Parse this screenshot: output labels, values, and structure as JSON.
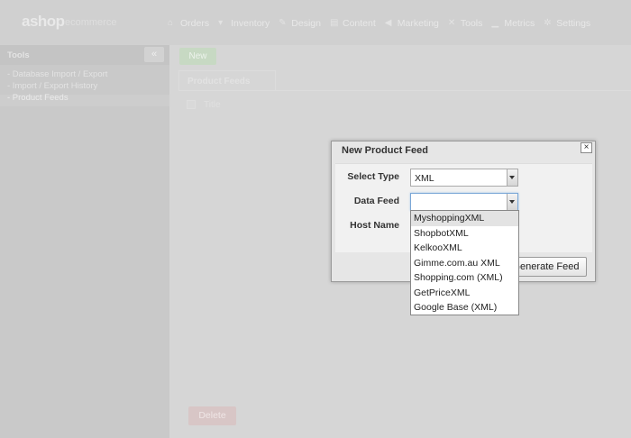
{
  "app": {
    "logo": "ashop",
    "logo_sub": "ecommerce"
  },
  "nav": [
    {
      "label": "Orders",
      "icon": "home-icon"
    },
    {
      "label": "Inventory",
      "icon": "cart-icon"
    },
    {
      "label": "Design",
      "icon": "brush-icon"
    },
    {
      "label": "Content",
      "icon": "book-icon"
    },
    {
      "label": "Marketing",
      "icon": "megaphone-icon"
    },
    {
      "label": "Tools",
      "icon": "tools-icon"
    },
    {
      "label": "Metrics",
      "icon": "bar-chart-icon"
    },
    {
      "label": "Settings",
      "icon": "gears-icon"
    }
  ],
  "sidebar": {
    "title": "Tools",
    "collapse": "«",
    "links": [
      {
        "label": "- Database Import / Export"
      },
      {
        "label": "- Import / Export History"
      },
      {
        "label": "- Product Feeds"
      }
    ]
  },
  "main": {
    "new_label": "New",
    "tab_label": "Product Feeds",
    "column_title": "Title",
    "delete_label": "Delete"
  },
  "dialog": {
    "title": "New Product Feed",
    "close": "×",
    "fields": {
      "select_type": {
        "label": "Select Type",
        "value": "XML"
      },
      "data_feed": {
        "label": "Data Feed",
        "value": ""
      },
      "host_name": {
        "label": "Host Name"
      }
    },
    "generate_label": "Generate Feed"
  },
  "dropdown": {
    "options": [
      "MyshoppingXML",
      "ShopbotXML",
      "KelkooXML",
      "Gimme.com.au XML",
      "Shopping.com (XML)",
      "GetPriceXML",
      "Google Base (XML)"
    ]
  }
}
